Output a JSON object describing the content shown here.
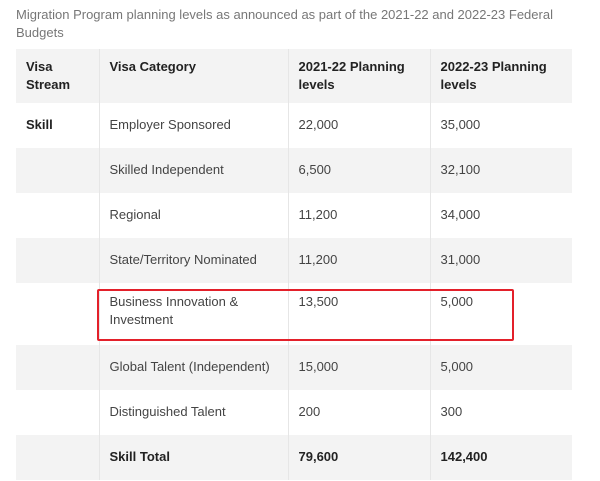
{
  "caption": "Migration Program planning levels as announced as part of the 2021-22 and 2022-23 Federal Budgets",
  "columns": [
    "Visa Stream",
    "Visa Category",
    "2021-22 Planning levels",
    "2022-23 Planning levels"
  ],
  "rows": [
    {
      "stream": "Skill",
      "category": "Employer Sponsored",
      "y2122": "22,000",
      "y2223": "35,000"
    },
    {
      "stream": "",
      "category": "Skilled Independent",
      "y2122": "6,500",
      "y2223": "32,100"
    },
    {
      "stream": "",
      "category": "Regional",
      "y2122": "11,200",
      "y2223": "34,000"
    },
    {
      "stream": "",
      "category": "State/Territory Nominated",
      "y2122": "11,200",
      "y2223": "31,000"
    },
    {
      "stream": "",
      "category": "Business Innovation & Investment",
      "y2122": "13,500",
      "y2223": "5,000"
    },
    {
      "stream": "",
      "category": "Global Talent (Independent)",
      "y2122": "15,000",
      "y2223": "5,000"
    },
    {
      "stream": "",
      "category": "Distinguished Talent",
      "y2122": "200",
      "y2223": "300"
    },
    {
      "stream": "",
      "category": "Skill Total",
      "y2122": "79,600",
      "y2223": "142,400"
    }
  ],
  "highlight_color": "#e3202a"
}
